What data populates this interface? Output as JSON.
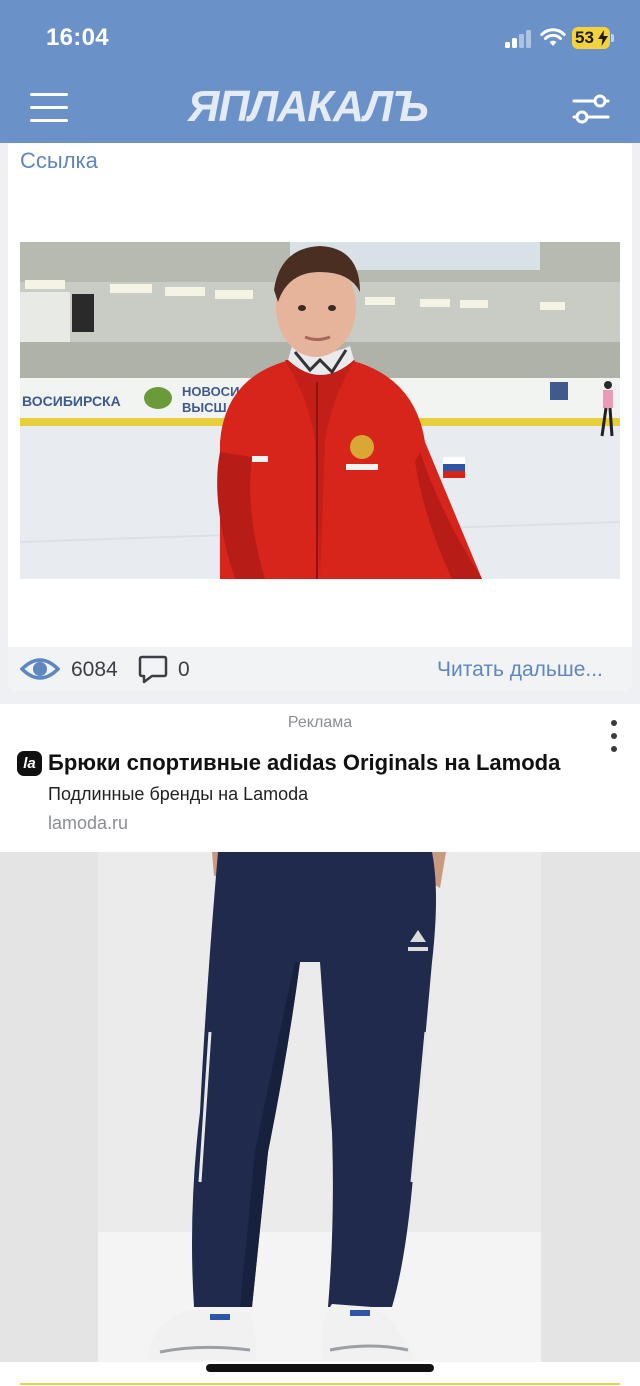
{
  "status_bar": {
    "time": "16:04",
    "battery": "53"
  },
  "header": {
    "logo": "ЯПЛАКАЛЪ",
    "icons": [
      "menu-icon",
      "filter-icon"
    ]
  },
  "post": {
    "link_label": "Ссылка",
    "views": "6084",
    "comments": "0",
    "read_more": "Читать дальше...",
    "image_icons": [
      "eye-icon",
      "comment-icon"
    ]
  },
  "ad": {
    "label": "Реклама",
    "brand_mark": "la",
    "title": "Брюки спортивные adidas Originals на Lamoda",
    "subtitle": "Подлинные бренды на Lamoda",
    "domain": "lamoda.ru"
  },
  "colors": {
    "header_bg": "#6a92c9",
    "accent_link": "#5e86c0",
    "battery": "#f4d23b"
  }
}
